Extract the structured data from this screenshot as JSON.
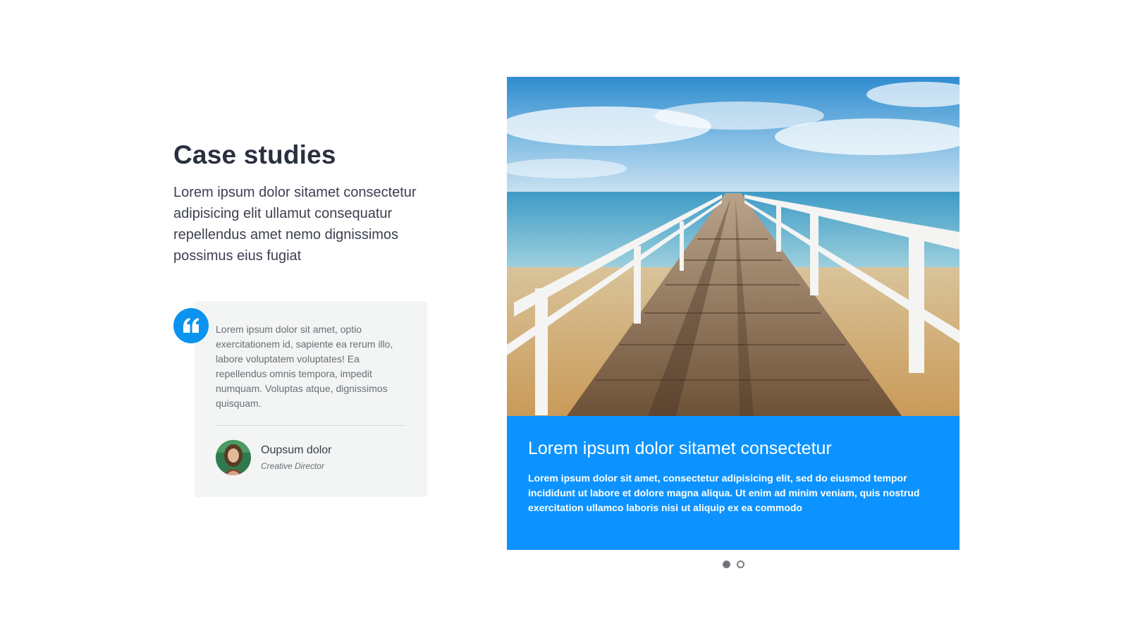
{
  "section": {
    "title": "Case studies",
    "intro": "Lorem ipsum dolor sitamet consectetur adipisicing elit ullamut consequatur repellendus amet nemo dignissimos possimus eius fugiat"
  },
  "testimonial": {
    "icon": "quote-icon",
    "text": "Lorem ipsum dolor sit amet, optio exercitationem id, sapiente ea rerum illo, labore voluptatem voluptates! Ea repellendus omnis tempora, impedit numquam. Voluptas atque, dignissimos quisquam.",
    "author_name": "Oupsum dolor",
    "author_role": "Creative Director"
  },
  "slider": {
    "caption_title": "Lorem ipsum dolor sitamet consectetur",
    "caption_text": "Lorem ipsum dolor sit amet, consectetur adipisicing elit, sed do eiusmod tempor incididunt ut labore et dolore magna aliqua. Ut enim ad minim veniam, quis nostrud exercitation ullamco laboris nisi ut aliquip ex ea commodo",
    "pagination": {
      "total": 2,
      "active": 1
    }
  },
  "colors": {
    "accent": "#0c93ff",
    "title": "#2b3040",
    "card_bg": "#f3f4f4"
  }
}
